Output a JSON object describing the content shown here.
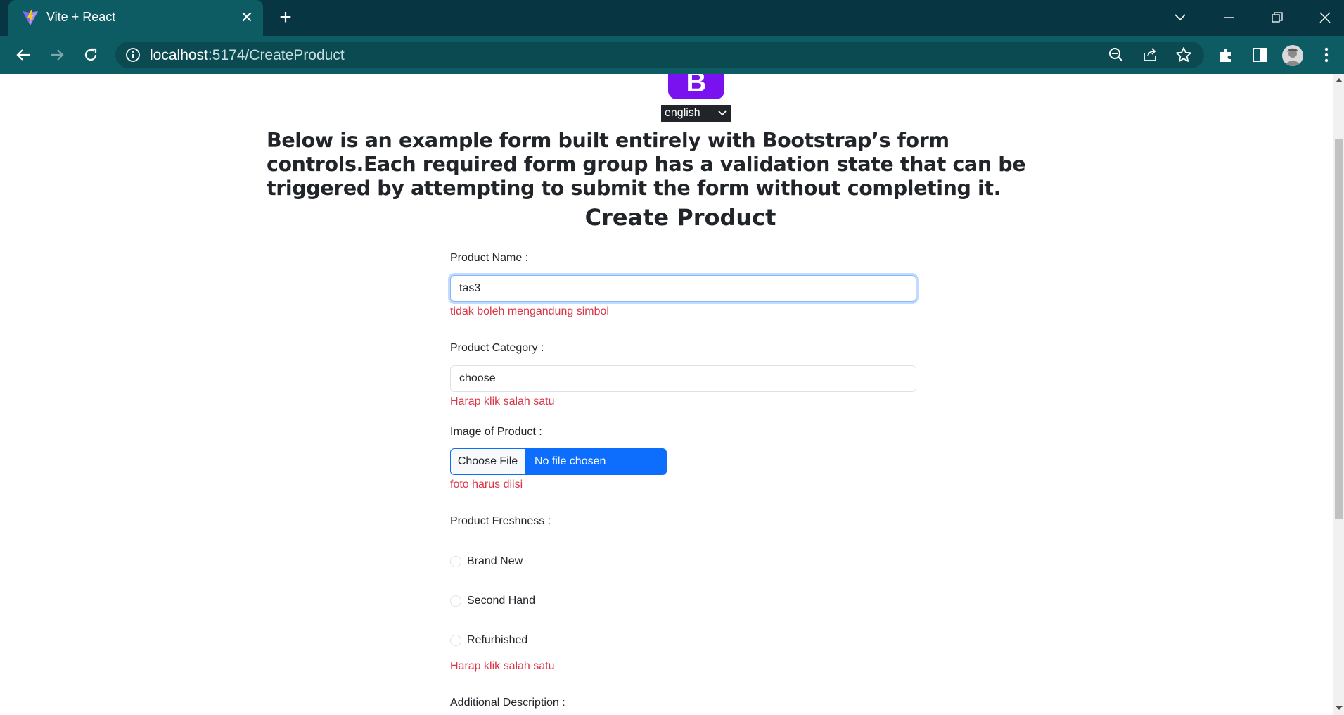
{
  "browser": {
    "tab_title": "Vite + React",
    "url_host": "localhost",
    "url_path": ":5174/CreateProduct"
  },
  "page": {
    "language_selected": "english",
    "intro": "Below is an example form built entirely with Bootstrap’s form controls.Each required form group has a validation state that can be triggered by attempting to submit the form without completing it.",
    "title": "Create Product",
    "product_name": {
      "label": "Product Name :",
      "value": "tas3",
      "error": "tidak boleh mengandung simbol"
    },
    "product_category": {
      "label": "Product Category :",
      "selected": "choose",
      "error": "Harap klik salah satu"
    },
    "image": {
      "label": "Image of Product :",
      "button": "Choose File",
      "status": "No file chosen",
      "error": "foto harus diisi"
    },
    "freshness": {
      "label": "Product Freshness :",
      "options": [
        "Brand New",
        "Second Hand",
        "Refurbished"
      ],
      "error": "Harap klik salah satu"
    },
    "description": {
      "label": "Additional Description :"
    }
  },
  "colors": {
    "chrome_bg": "#073642",
    "toolbar_bg": "#0e5c63",
    "error": "#dc3545",
    "primary": "#0d6efd",
    "logo": "#7a12f0"
  }
}
